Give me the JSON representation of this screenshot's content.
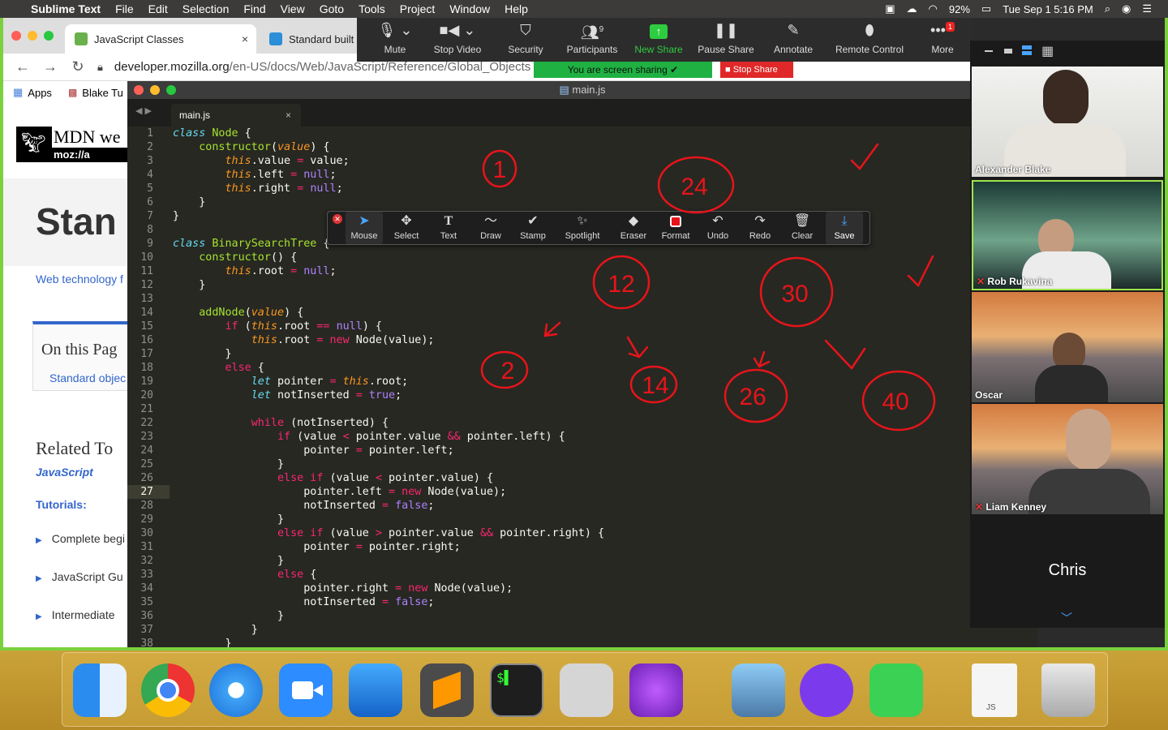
{
  "menubar": {
    "apple": "",
    "app": "Sublime Text",
    "items": [
      "File",
      "Edit",
      "Selection",
      "Find",
      "View",
      "Goto",
      "Tools",
      "Project",
      "Window",
      "Help"
    ],
    "battery": "92%",
    "datetime": "Tue Sep 1  5:16 PM"
  },
  "browser": {
    "tabs": [
      {
        "label": "JavaScript Classes"
      },
      {
        "label": "Standard built"
      }
    ],
    "url_host": "developer.mozilla.org",
    "url_path": "/en-US/docs/Web/JavaScript/Reference/Global_Objects",
    "bookmarks": [
      "Apps",
      "Blake Tu"
    ],
    "page": {
      "logo": "MDN we",
      "logo2": "moz://a",
      "title": "Stan",
      "subtitle": "Web technology f",
      "on_this_page": "On this Pag",
      "otp_item": "Standard objec",
      "related": "Related To",
      "related_js": "JavaScript",
      "tutorials": "Tutorials:",
      "items": [
        "Complete begi",
        "JavaScript Gu",
        "Intermediate"
      ]
    }
  },
  "zoom": {
    "toolbar": [
      {
        "label": "Mute",
        "icon": "microphone-icon"
      },
      {
        "label": "Stop Video",
        "icon": "camera-icon"
      },
      {
        "label": "Security",
        "icon": "shield-icon"
      },
      {
        "label": "Participants",
        "icon": "people-icon",
        "count": "9"
      },
      {
        "label": "New Share",
        "icon": "share-arrow-icon"
      },
      {
        "label": "Pause Share",
        "icon": "pause-icon"
      },
      {
        "label": "Annotate",
        "icon": "pencil-icon"
      },
      {
        "label": "Remote Control",
        "icon": "mouse-icon"
      },
      {
        "label": "More",
        "icon": "ellipsis-icon",
        "badge": "1"
      }
    ],
    "sharing": "You are screen sharing",
    "stop_share": "Stop Share",
    "annotate": [
      {
        "label": "Mouse",
        "icon": "cursor-icon"
      },
      {
        "label": "Select",
        "icon": "move-icon"
      },
      {
        "label": "Text",
        "icon": "text-icon"
      },
      {
        "label": "Draw",
        "icon": "squiggle-icon"
      },
      {
        "label": "Stamp",
        "icon": "check-icon"
      },
      {
        "label": "Spotlight",
        "icon": "wand-icon"
      },
      {
        "label": "Eraser",
        "icon": "eraser-icon"
      },
      {
        "label": "Format",
        "icon": "red-square-icon"
      },
      {
        "label": "Undo",
        "icon": "undo-icon"
      },
      {
        "label": "Redo",
        "icon": "redo-icon"
      },
      {
        "label": "Clear",
        "icon": "trash-icon"
      },
      {
        "label": "Save",
        "icon": "save-icon"
      }
    ],
    "participants": [
      "Alexander Blake",
      "Rob Rukavina",
      "Oscar",
      "Liam Kenney",
      "Chris"
    ]
  },
  "editor": {
    "title": "main.js",
    "tab": "main.js",
    "current_line": 27,
    "line_numbers": [
      "1",
      "2",
      "3",
      "4",
      "5",
      "6",
      "7",
      "8",
      "9",
      "10",
      "11",
      "12",
      "13",
      "14",
      "15",
      "16",
      "17",
      "18",
      "19",
      "20",
      "21",
      "22",
      "23",
      "24",
      "25",
      "26",
      "27",
      "28",
      "29",
      "30",
      "31",
      "32",
      "33",
      "34",
      "35",
      "36",
      "37",
      "38"
    ]
  },
  "annotations": [
    "1",
    "24",
    "12",
    "30",
    "2",
    "14",
    "26",
    "40"
  ],
  "dock": [
    "Finder",
    "Chrome",
    "Safari",
    "Zoom",
    "Xcode",
    "Sublime Text",
    "Terminal",
    "Calculator",
    "iMovie",
    "Preview",
    "GitHub Desktop",
    "FaceTime",
    "JS",
    "Trash"
  ],
  "colors": {
    "frame": "#7ad13d",
    "editor_bg": "#272822",
    "ink": "#e8141a",
    "zoom_green": "#1fb141",
    "stop_red": "#e02828"
  }
}
